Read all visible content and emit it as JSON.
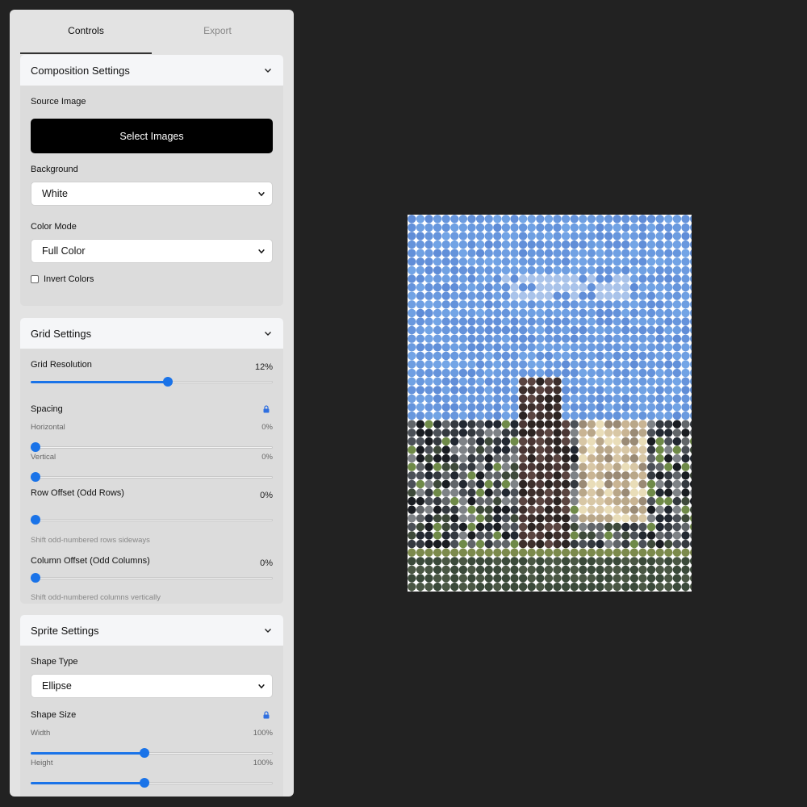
{
  "tabs": [
    "Controls",
    "Export"
  ],
  "composition": {
    "title": "Composition Settings",
    "source_label": "Source Image",
    "select_button": "Select Images",
    "background_label": "Background",
    "background_value": "White",
    "color_mode_label": "Color Mode",
    "color_mode_value": "Full Color",
    "invert_label": "Invert Colors",
    "invert_checked": false
  },
  "grid": {
    "title": "Grid Settings",
    "resolution_label": "Grid Resolution",
    "resolution_value": "12%",
    "resolution_level": 0.57,
    "spacing_label": "Spacing",
    "horizontal_label": "Horizontal",
    "horizontal_value": "0%",
    "horizontal_level": 0,
    "vertical_label": "Vertical",
    "vertical_value": "0%",
    "vertical_level": 0,
    "row_offset_label": "Row Offset (Odd Rows)",
    "row_offset_value": "0%",
    "row_offset_level": 0,
    "row_offset_hint": "Shift odd-numbered rows sideways",
    "col_offset_label": "Column Offset (Odd Columns)",
    "col_offset_value": "0%",
    "col_offset_level": 0,
    "col_offset_hint": "Shift odd-numbered columns vertically"
  },
  "sprite": {
    "title": "Sprite Settings",
    "shape_type_label": "Shape Type",
    "shape_type_value": "Ellipse",
    "shape_size_label": "Shape Size",
    "width_label": "Width",
    "width_value": "100%",
    "width_level": 0.47,
    "height_label": "Height",
    "height_value": "100%",
    "height_level": 0.47
  },
  "colors": {
    "accent": "#1a73e8",
    "panel_bg": "#e3e3e3",
    "section_bg": "#dcdcdc",
    "app_bg": "#222222"
  }
}
